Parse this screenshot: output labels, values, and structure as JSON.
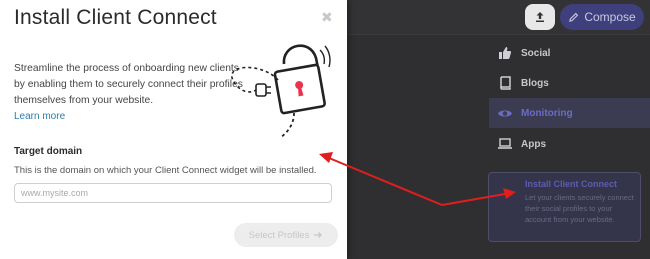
{
  "header": {
    "upload_icon": "upload-icon",
    "compose_label": "Compose",
    "compose_icon": "pencil-icon"
  },
  "sidebar": {
    "items": [
      {
        "label": "Social",
        "icon": "thumbs-up-icon",
        "active": false
      },
      {
        "label": "Blogs",
        "icon": "book-icon",
        "active": false
      },
      {
        "label": "Monitoring",
        "icon": "eye-icon",
        "active": true
      },
      {
        "label": "Apps",
        "icon": "laptop-icon",
        "active": false
      }
    ]
  },
  "promo": {
    "title": "Install Client Connect",
    "body": "Let your clients securely connect their social profiles to your account from your website."
  },
  "modal": {
    "title": "Install Client Connect",
    "close_icon": "close-icon",
    "intro": "Streamline the process of onboarding new clients by enabling them to securely connect their profiles themselves from your website.",
    "learn_more": "Learn more",
    "field_label": "Target domain",
    "field_help": "This is the domain on which your Client Connect widget will be installed.",
    "input_placeholder": "www.mysite.com",
    "input_value": "",
    "submit_label": "Select Profiles",
    "submit_enabled": false
  },
  "colors": {
    "accent": "#2a7fb0",
    "annotation_arrow": "#e01e1e",
    "active_nav": "#6c6cc4",
    "lock_keyhole": "#e8344e"
  }
}
